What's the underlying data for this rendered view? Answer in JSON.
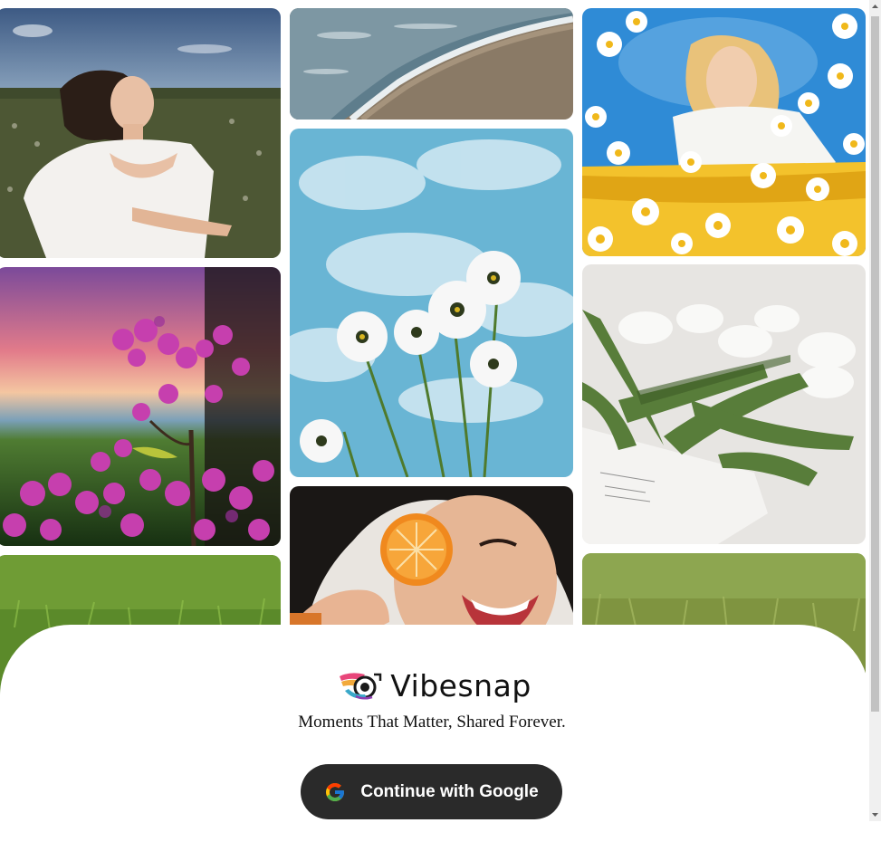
{
  "app": {
    "name": "Vibesnap",
    "tagline": "Moments That Matter, Shared Forever.",
    "logo_icon": "camera-eye-logo-icon"
  },
  "auth": {
    "google_button_label": "Continue with Google",
    "google_icon": "google-g-icon"
  },
  "gallery": {
    "images": [
      "woman-white-dress-field",
      "purple-flowers-sunset",
      "green-grass",
      "beach-shoreline",
      "white-cosmos-flowers-sky",
      "woman-orange-slice-smile",
      "woman-daisies-blue-sky",
      "white-tulips-newspaper",
      "green-meadow"
    ]
  },
  "colors": {
    "button_bg": "#2a2a2a",
    "button_text": "#ffffff",
    "sheet_bg": "#ffffff",
    "text": "#111111"
  }
}
